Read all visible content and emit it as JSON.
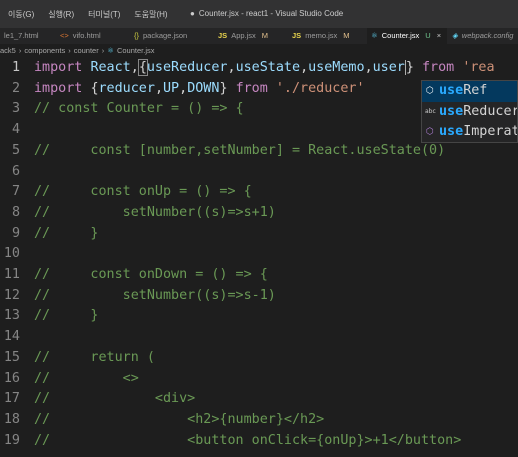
{
  "titlebar": {
    "menu": [
      "이동(G)",
      "실행(R)",
      "터미널(T)",
      "도움말(H)"
    ],
    "dot": "●",
    "title": "Counter.jsx - react1 - Visual Studio Code"
  },
  "tabs": [
    {
      "label": "le1_7.html",
      "icon": "html-file-icon"
    },
    {
      "label": "vifo.html",
      "icon": "html-file-icon"
    },
    {
      "label": "package.json",
      "icon": "json-file-icon"
    },
    {
      "label": "App.jsx",
      "status": "M",
      "icon": "js-file-icon"
    },
    {
      "label": "memo.jsx",
      "status": "M",
      "icon": "js-file-icon"
    },
    {
      "label": "Counter.jsx",
      "status": "U",
      "icon": "react-file-icon"
    },
    {
      "label": "webpack.config",
      "icon": "webpack-file-icon"
    }
  ],
  "breadcrumb": [
    "ack5",
    "components",
    "counter",
    "Counter.jsx"
  ],
  "editor": {
    "line_numbers": [
      "1",
      "2",
      "3",
      "4",
      "5",
      "6",
      "7",
      "8",
      "9",
      "10",
      "11",
      "12",
      "13",
      "14",
      "15",
      "16",
      "17",
      "18",
      "19"
    ],
    "lines": [
      [
        [
          "kw",
          "import "
        ],
        [
          "id",
          "React"
        ],
        [
          "pl",
          ","
        ],
        [
          "pl",
          "{"
        ],
        [
          "id",
          "useReducer"
        ],
        [
          "pl",
          ","
        ],
        [
          "id",
          "useState"
        ],
        [
          "pl",
          ","
        ],
        [
          "id",
          "useMemo"
        ],
        [
          "pl",
          ","
        ],
        [
          "id",
          "user"
        ],
        [
          "pl",
          "} "
        ],
        [
          "kw",
          "from "
        ],
        [
          "str",
          "'rea"
        ]
      ],
      [
        [
          "kw",
          "import "
        ],
        [
          "pl",
          "{"
        ],
        [
          "id",
          "reducer"
        ],
        [
          "pl",
          ","
        ],
        [
          "id",
          "UP"
        ],
        [
          "pl",
          ","
        ],
        [
          "id",
          "DOWN"
        ],
        [
          "pl",
          "} "
        ],
        [
          "kw",
          "from "
        ],
        [
          "str",
          "'./reducer'"
        ]
      ],
      [
        [
          "cm",
          "// const Counter = () => {"
        ]
      ],
      [
        [
          "cm",
          ""
        ]
      ],
      [
        [
          "cm",
          "//     const [number,setNumber] = React.useState(0)"
        ]
      ],
      [
        [
          "cm",
          ""
        ]
      ],
      [
        [
          "cm",
          "//     const onUp = () => {"
        ]
      ],
      [
        [
          "cm",
          "//         setNumber((s)=>s+1)"
        ]
      ],
      [
        [
          "cm",
          "//     }"
        ]
      ],
      [
        [
          "cm",
          ""
        ]
      ],
      [
        [
          "cm",
          "//     const onDown = () => {"
        ]
      ],
      [
        [
          "cm",
          "//         setNumber((s)=>s-1)"
        ]
      ],
      [
        [
          "cm",
          "//     }"
        ]
      ],
      [
        [
          "cm",
          ""
        ]
      ],
      [
        [
          "cm",
          "//     return ("
        ]
      ],
      [
        [
          "cm",
          "//         <>"
        ]
      ],
      [
        [
          "cm",
          "//             <div>"
        ]
      ],
      [
        [
          "cm",
          "//                 <h2>{number}</h2>"
        ]
      ],
      [
        [
          "cm",
          "//                 <button onClick={onUp}>+1</button>"
        ]
      ]
    ]
  },
  "suggest": {
    "items": [
      {
        "prefix": "use",
        "rest": "Ref",
        "kind": "symbol"
      },
      {
        "prefix": "use",
        "rest": "Reducer",
        "kind": "abc"
      },
      {
        "prefix": "use",
        "rest": "Imperat",
        "kind": "symbol"
      }
    ],
    "abc_label": "abc",
    "symbol_glyph": "⬡"
  }
}
